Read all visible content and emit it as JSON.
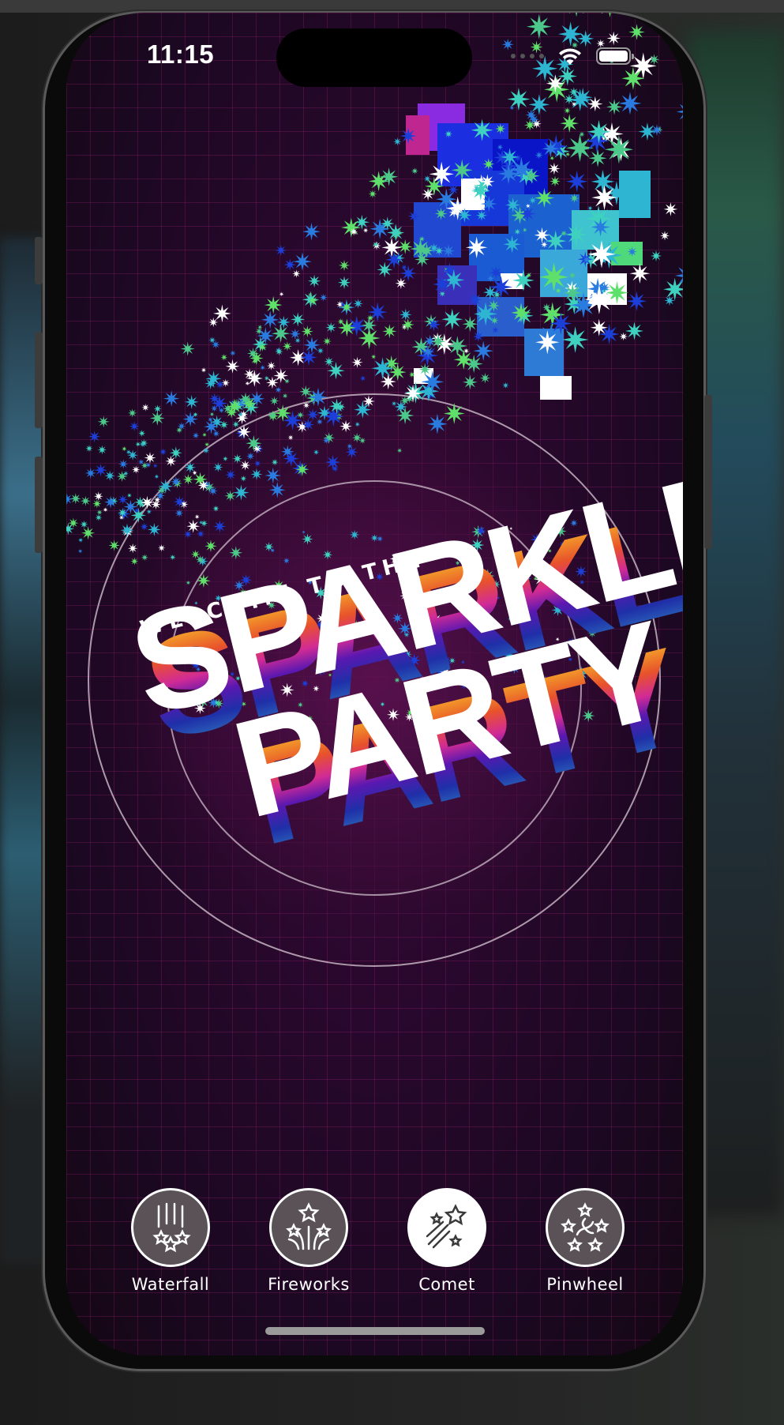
{
  "status_bar": {
    "time": "11:15",
    "icons": [
      "cellular-dots-icon",
      "wifi-icon",
      "battery-icon"
    ]
  },
  "artwork": {
    "welcome_text": "WELCOME TO THE",
    "title_line1": "SPARKLE",
    "title_line2": "PARTY"
  },
  "controls": [
    {
      "label": "Waterfall",
      "icon": "waterfall-icon",
      "selected": false
    },
    {
      "label": "Fireworks",
      "icon": "fireworks-icon",
      "selected": false
    },
    {
      "label": "Comet",
      "icon": "comet-icon",
      "selected": true
    },
    {
      "label": "Pinwheel",
      "icon": "pinwheel-icon",
      "selected": false
    }
  ],
  "colors": {
    "background": "#25082a",
    "grid": "#c8288c",
    "accent_teal": "#3fd1c0",
    "accent_green": "#5fe06a",
    "accent_blue": "#1b3fd8"
  }
}
